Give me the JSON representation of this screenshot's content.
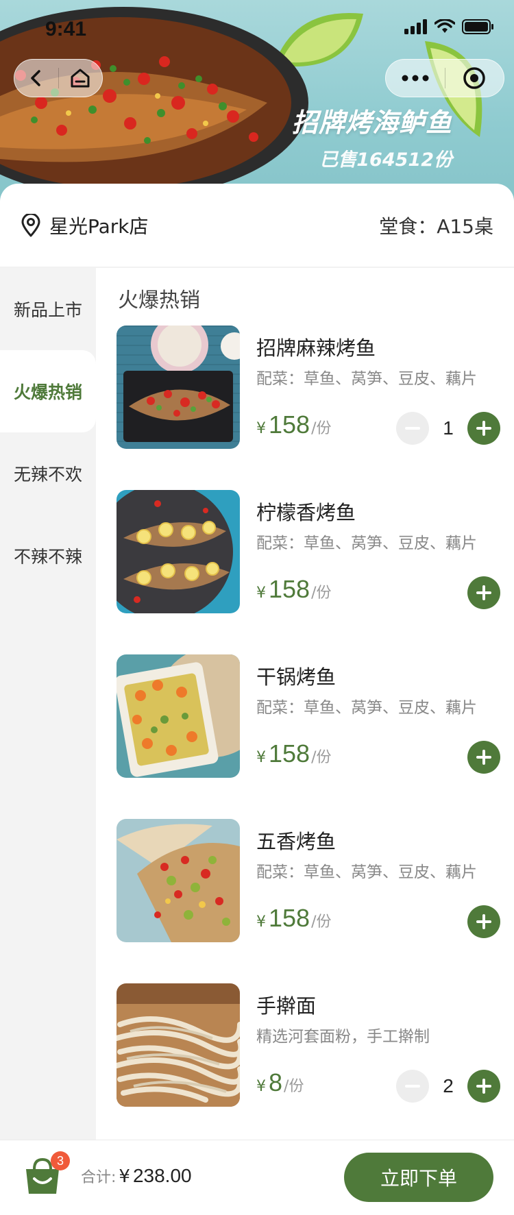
{
  "status_bar": {
    "time": "9:41"
  },
  "hero": {
    "promo_title": "招牌烤海鲈鱼",
    "promo_sub": "已售164512份"
  },
  "nav": {
    "back_icon": "chevron-left-icon",
    "home_icon": "home-icon",
    "more_icon": "more-dots-icon",
    "close_icon": "target-icon"
  },
  "store": {
    "name": "星光Park店",
    "dine_label": "堂食：",
    "table": "A15桌"
  },
  "categories": [
    {
      "label": "新品上市",
      "active": false
    },
    {
      "label": "火爆热销",
      "active": true
    },
    {
      "label": "无辣不欢",
      "active": false
    },
    {
      "label": "不辣不辣",
      "active": false
    }
  ],
  "section": {
    "title": "火爆热销"
  },
  "items": [
    {
      "name": "招牌麻辣烤鱼",
      "desc": "配菜：草鱼、莴笋、豆皮、藕片",
      "currency": "¥",
      "price": "158",
      "unit": "/份",
      "qty": "1"
    },
    {
      "name": "柠檬香烤鱼",
      "desc": "配菜：草鱼、莴笋、豆皮、藕片",
      "currency": "¥",
      "price": "158",
      "unit": "/份",
      "qty": null
    },
    {
      "name": "干锅烤鱼",
      "desc": "配菜：草鱼、莴笋、豆皮、藕片",
      "currency": "¥",
      "price": "158",
      "unit": "/份",
      "qty": null
    },
    {
      "name": "五香烤鱼",
      "desc": "配菜：草鱼、莴笋、豆皮、藕片",
      "currency": "¥",
      "price": "158",
      "unit": "/份",
      "qty": null
    },
    {
      "name": "手擀面",
      "desc": "精选河套面粉，手工擀制",
      "currency": "¥",
      "price": "8",
      "unit": "/份",
      "qty": "2"
    }
  ],
  "cart": {
    "badge": "3",
    "total_label": "合计:",
    "currency": "¥",
    "total": "238.00",
    "order_button": "立即下单"
  },
  "colors": {
    "accent": "#4f7a3a",
    "badge": "#f05a3a",
    "sidebar_bg": "#f3f3f3"
  }
}
